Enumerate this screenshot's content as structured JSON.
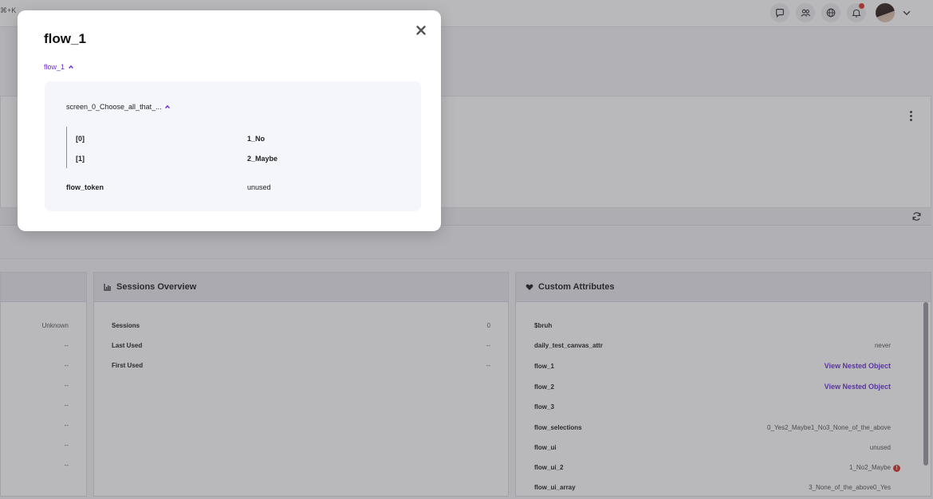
{
  "topbar": {
    "shortcut": "⌘+K",
    "icons": [
      "chat-icon",
      "users-icon",
      "globe-icon",
      "bell-icon"
    ],
    "has_notification": true
  },
  "left_card": {
    "values": [
      "Unknown",
      "--",
      "--",
      "--",
      "--",
      "--",
      "--",
      "--"
    ]
  },
  "sessions": {
    "title": "Sessions Overview",
    "rows": [
      {
        "label": "Sessions",
        "value": "0"
      },
      {
        "label": "Last Used",
        "value": "--"
      },
      {
        "label": "First Used",
        "value": "--"
      }
    ]
  },
  "custom_attributes": {
    "title": "Custom Attributes",
    "rows": [
      {
        "key": "$bruh",
        "value": ""
      },
      {
        "key": "daily_test_canvas_attr",
        "value": "never"
      },
      {
        "key": "flow_1",
        "value": "View Nested Object"
      },
      {
        "key": "flow_2",
        "value": "View Nested Object"
      },
      {
        "key": "flow_3",
        "value": ""
      },
      {
        "key": "flow_selections",
        "value": "0_Yes2_Maybe1_No3_None_of_the_above"
      },
      {
        "key": "flow_ui",
        "value": "unused"
      },
      {
        "key": "flow_ui_2",
        "value": "1_No2_Maybe"
      },
      {
        "key": "flow_ui_array",
        "value": "3_None_of_the_above0_Yes"
      }
    ]
  },
  "modal": {
    "title": "flow_1",
    "toggle_label": "flow_1",
    "screen_key": "screen_0_Choose_all_that_...",
    "array_items": [
      {
        "index": "[0]",
        "value": "1_No"
      },
      {
        "index": "[1]",
        "value": "2_Maybe"
      }
    ],
    "token_key": "flow_token",
    "token_value": "unused"
  },
  "colors": {
    "accent": "#6b2fd6",
    "alert": "#d8352a",
    "overlay": "rgba(60,60,70,0.36)"
  }
}
